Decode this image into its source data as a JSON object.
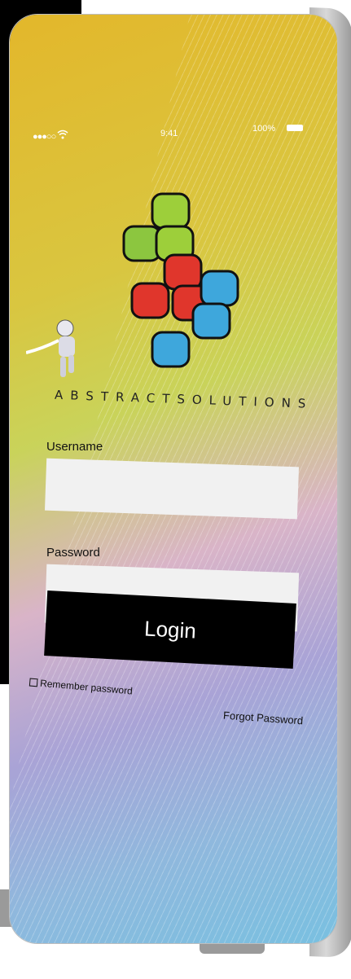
{
  "status_bar": {
    "signal": "●●●○○",
    "time": "9:41",
    "battery_percent": "100%"
  },
  "brand": {
    "name": "ABSTRACTSOLUTIONS"
  },
  "form": {
    "username_label": "Username",
    "username_value": "",
    "password_label": "Password",
    "password_value": "",
    "login_label": "Login",
    "remember_label": "Remember password",
    "remember_checked": false,
    "forgot_label": "Forgot Password"
  },
  "colors": {
    "login_button": "#000000",
    "field_bg": "#f1f1f1"
  }
}
